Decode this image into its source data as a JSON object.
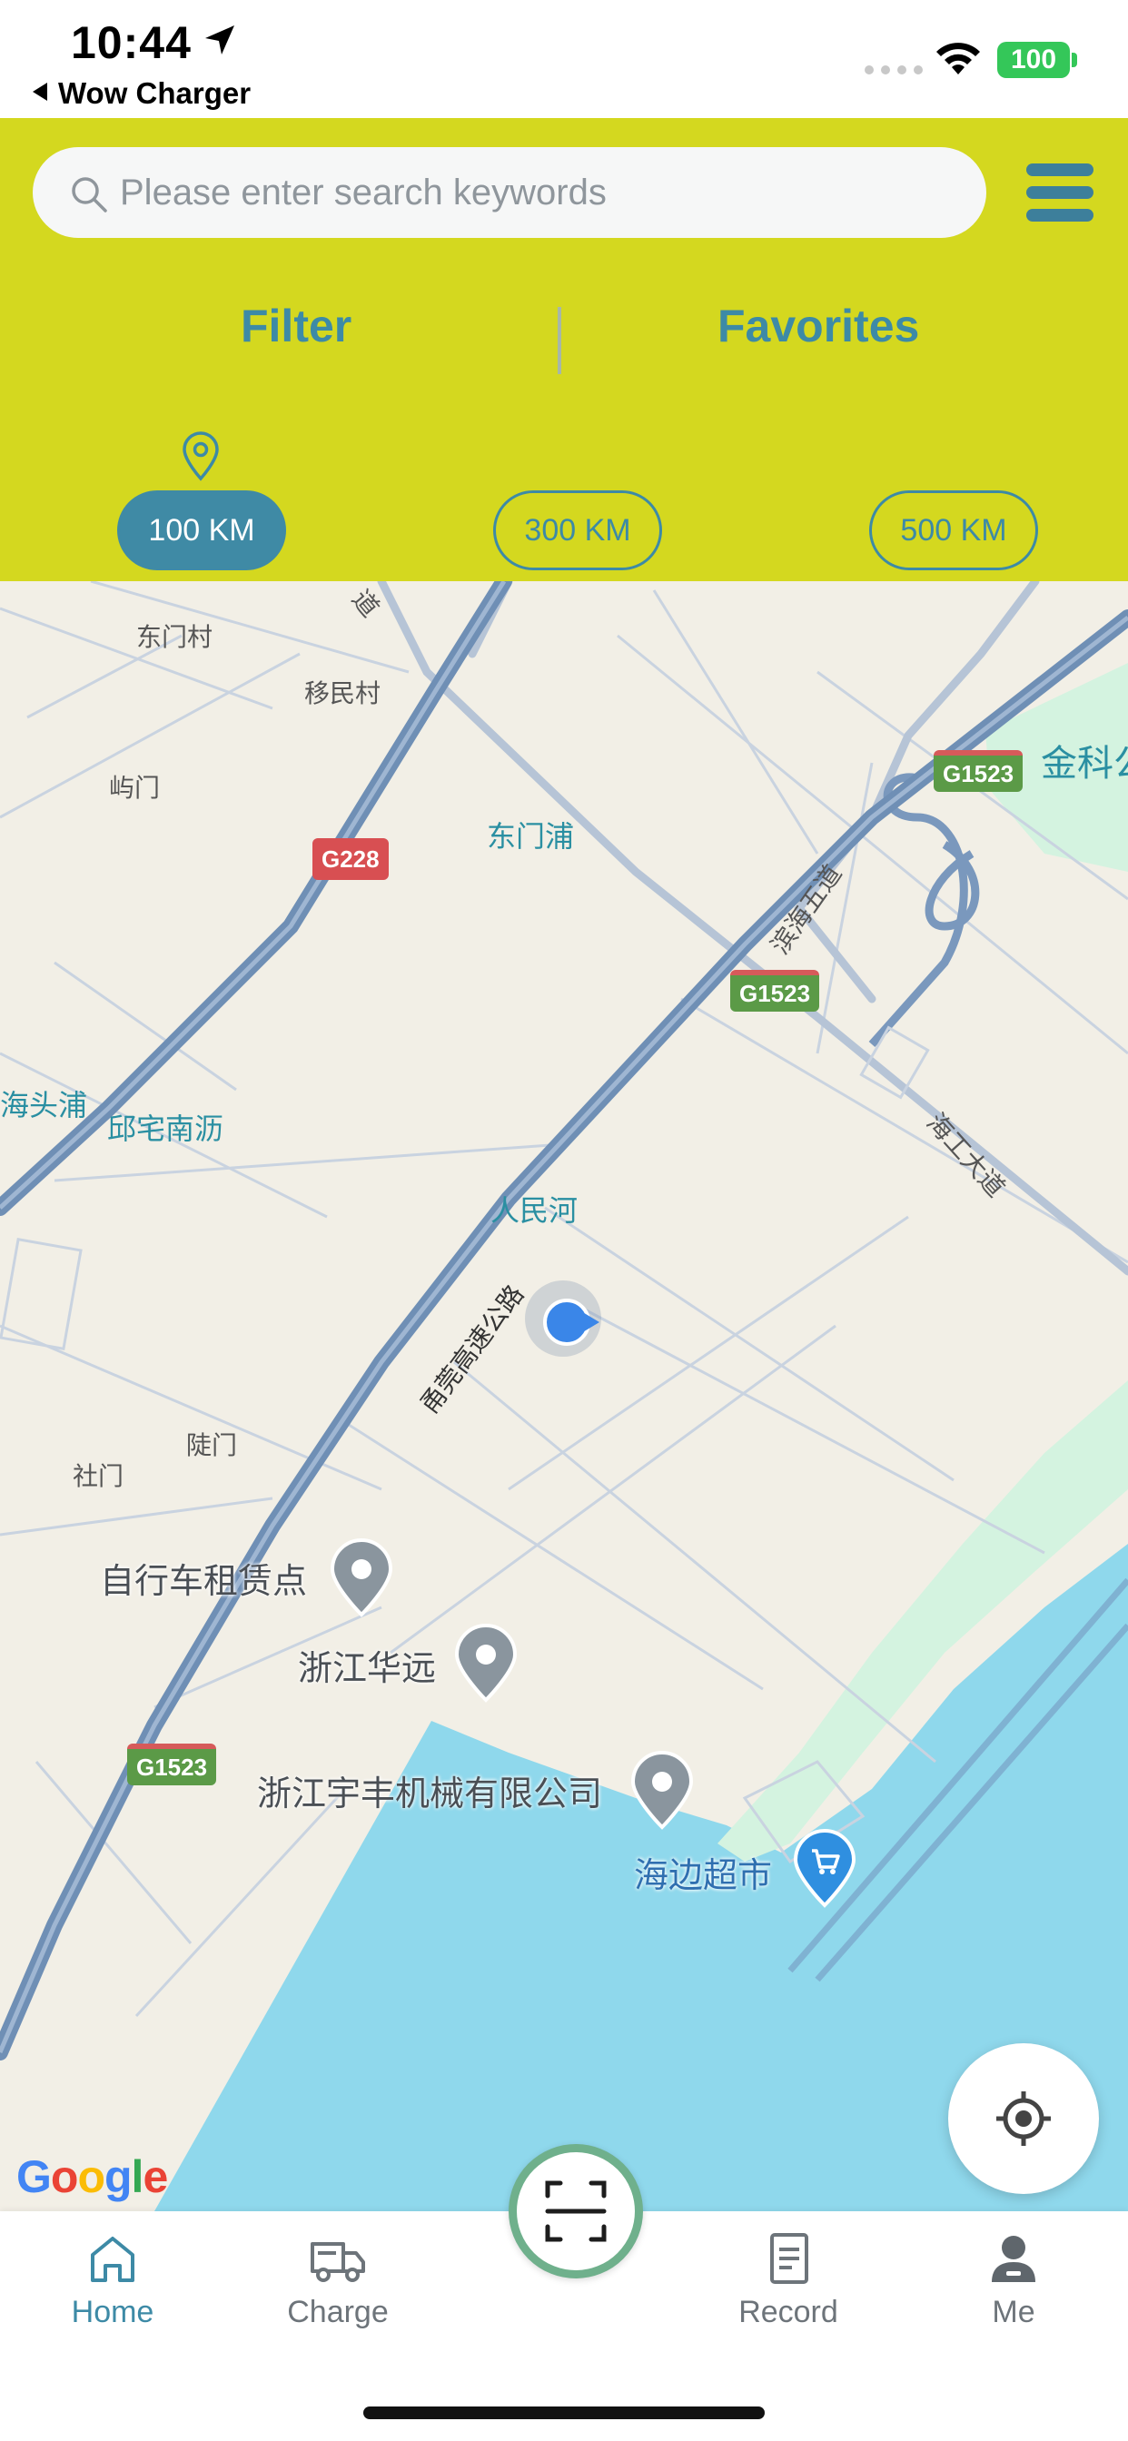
{
  "status_bar": {
    "time": "10:44",
    "back_app": "Wow Charger",
    "battery": "100"
  },
  "search": {
    "placeholder": "Please enter search keywords"
  },
  "tabs": {
    "filter": "Filter",
    "favorites": "Favorites"
  },
  "distances": [
    "100 KM",
    "300 KM",
    "500 KM"
  ],
  "selected_distance": "100 KM",
  "map": {
    "places": [
      "东门村",
      "移民村",
      "屿门",
      "东门浦",
      "海头浦",
      "邱宅南沥",
      "人民河",
      "陡门",
      "社门",
      "金科公",
      "滨海五道",
      "海工大道",
      "甬莞高速公路",
      "道"
    ],
    "shields": [
      "G1523",
      "G1523",
      "G1523",
      "G228"
    ],
    "pois": [
      "自行车租赁点",
      "浙江华远",
      "浙江宇丰机械有限公司",
      "海边超市"
    ],
    "provider": "Google"
  },
  "nav": {
    "home": "Home",
    "charge": "Charge",
    "record": "Record",
    "me": "Me"
  },
  "colors": {
    "header": "#d4d81f",
    "accent": "#3d8aa6",
    "water": "#8fd8ec",
    "park": "#d4f3e0",
    "highway": "#6f8fb5",
    "scan_ring": "#6fb08c"
  },
  "icons": [
    "location-arrow-icon",
    "wifi-icon",
    "search-icon",
    "menu-icon",
    "pin-icon",
    "poi-pin-icon",
    "cart-pin-icon",
    "locate-icon",
    "home-icon",
    "truck-icon",
    "scan-icon",
    "document-icon",
    "user-icon"
  ]
}
